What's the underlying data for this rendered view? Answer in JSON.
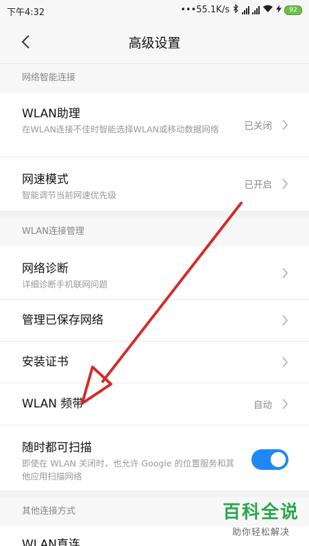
{
  "status_bar": {
    "time": "下午4:32",
    "network_speed": "•••55.1K/s",
    "battery": "92"
  },
  "header": {
    "title": "高级设置"
  },
  "sections": [
    {
      "heading": "网络智能连接",
      "items": [
        {
          "label": "WLAN助理",
          "desc": "在WLAN连接不佳时智能选择WLAN或移动数据网络",
          "value": "已关闭"
        },
        {
          "label": "网速模式",
          "desc": "智能调节当前网速优先级",
          "value": "已开启"
        }
      ]
    },
    {
      "heading": "WLAN连接管理",
      "items": [
        {
          "label": "网络诊断",
          "desc": "详细诊断手机联网问题",
          "value": ""
        },
        {
          "label": "管理已保存网络",
          "desc": "",
          "value": ""
        },
        {
          "label": "安装证书",
          "desc": "",
          "value": ""
        },
        {
          "label": "WLAN 频带",
          "desc": "",
          "value": "自动"
        },
        {
          "label": "随时都可扫描",
          "desc": "即使在 WLAN 关闭时，也允许 Google 的位置服务和其他应用扫描网络",
          "toggle": true
        }
      ]
    },
    {
      "heading": "其他连接方式",
      "items": [
        {
          "label": "WLAN直连"
        }
      ]
    }
  ],
  "watermark": {
    "main": "百科全说",
    "sub": "助你轻松解决"
  },
  "colors": {
    "accent": "#1e88f5",
    "arrow": "#d42a2a",
    "watermark": "#2aa64a"
  }
}
